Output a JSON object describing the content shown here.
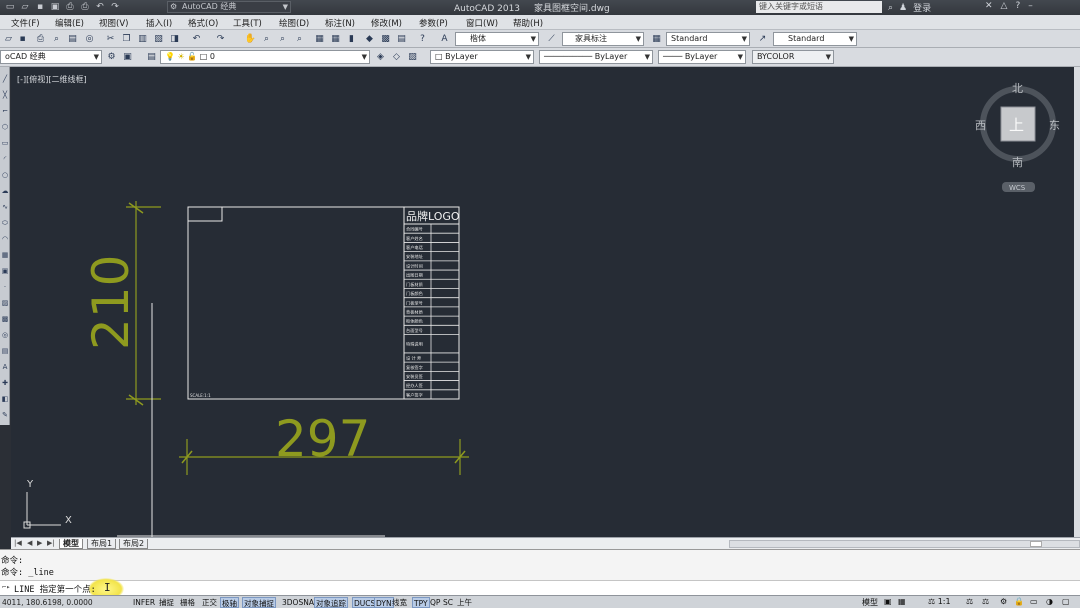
{
  "title": {
    "app": "AutoCAD 2013",
    "file": "家具图框空间.dwg",
    "workspace": "AutoCAD 经典",
    "search_placeholder": "键入关键字或短语",
    "login": "登录"
  },
  "menu": [
    "文件(F)",
    "编辑(E)",
    "视图(V)",
    "插入(I)",
    "格式(O)",
    "工具(T)",
    "绘图(D)",
    "标注(N)",
    "修改(M)",
    "参数(P)",
    "窗口(W)",
    "帮助(H)"
  ],
  "toolbar1": {
    "text_style": "楷体",
    "dim_style": "家具标注",
    "table_style": "Standard",
    "multileader_style": "Standard"
  },
  "toolbar2": {
    "workspace": "oCAD 经典",
    "layer": "0",
    "color": "ByLayer",
    "linetype": "ByLayer",
    "lineweight": "ByLayer",
    "plotstyle": "BYCOLOR"
  },
  "viewport": {
    "label": "[-][俯视][二维线框]"
  },
  "viewcube": {
    "north": "北",
    "south": "南",
    "east": "东",
    "west": "西",
    "top": "上",
    "wcs": "WCS"
  },
  "drawing": {
    "dim_height": "210",
    "dim_width": "297",
    "title_logo": "品牌LOGO",
    "scale_note": "SCALE:1:1",
    "title_rows": [
      "合同编号",
      "客户姓名",
      "客户电话",
      "安装地址",
      "设计时间",
      "出图日期",
      "门板材质",
      "门板颜色",
      "门板型号",
      "背板材质",
      "柜体颜色",
      "台面型号",
      "特殊说明",
      "设 计 师",
      "复核签字",
      "安装员签",
      "经办人签",
      "客户签字"
    ]
  },
  "ucs": {
    "x": "X",
    "y": "Y"
  },
  "layout_tabs": [
    "模型",
    "布局1",
    "布局2"
  ],
  "command": {
    "history": [
      "命令:",
      "命令: _line"
    ],
    "prompt": "LINE 指定第一个点:"
  },
  "status": {
    "coords": "4011, 180.6198, 0.0000",
    "toggles": [
      "INFER",
      "捕捉",
      "栅格",
      "正交",
      "极轴",
      "对象捕捉",
      "3DOSNAP",
      "对象追踪",
      "DUCS",
      "DYN",
      "线宽",
      "TPY",
      "QP",
      "SC",
      "上午"
    ],
    "right": {
      "model": "模型",
      "scale": "1:1"
    }
  },
  "colors": {
    "viewport_bg": "#262c35",
    "dimension": "#8e9a1f",
    "linework": "#ffffff",
    "highlight": "#f2e34a"
  }
}
